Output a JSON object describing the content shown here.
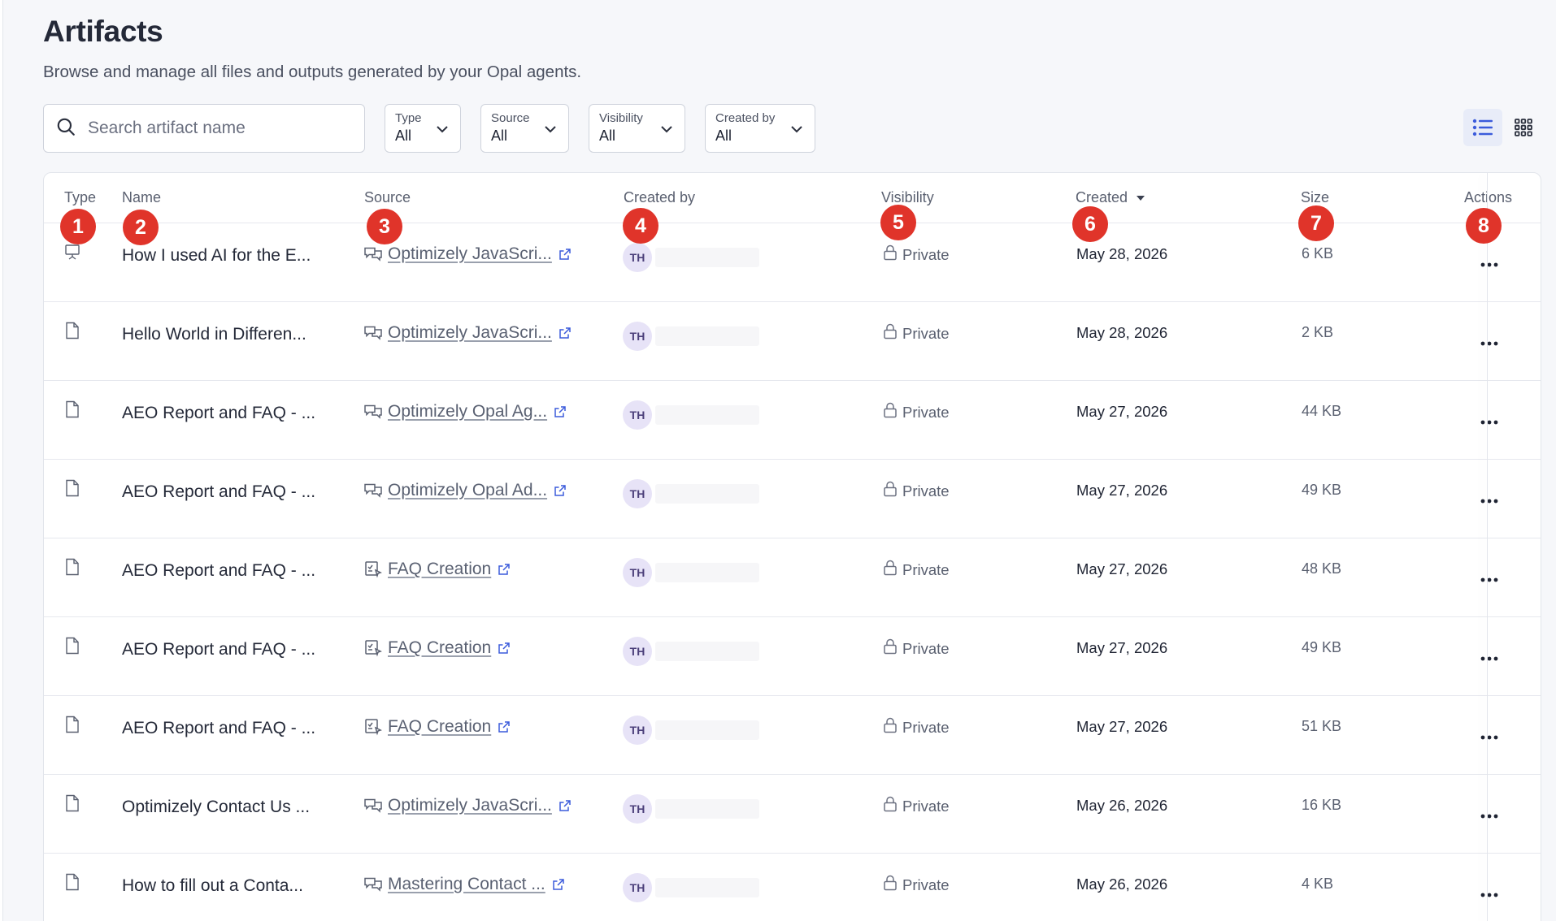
{
  "page": {
    "title": "Artifacts",
    "subtitle": "Browse and manage all files and outputs generated by your Opal agents."
  },
  "search": {
    "placeholder": "Search artifact name",
    "value": ""
  },
  "filters": [
    {
      "label": "Type",
      "value": "All"
    },
    {
      "label": "Source",
      "value": "All"
    },
    {
      "label": "Visibility",
      "value": "All"
    },
    {
      "label": "Created by",
      "value": "All"
    }
  ],
  "view_toggle": {
    "active": "list",
    "list_icon": "list-view-icon",
    "grid_icon": "grid-view-icon"
  },
  "table": {
    "columns": {
      "type": "Type",
      "name": "Name",
      "source": "Source",
      "created_by": "Created by",
      "visibility": "Visibility",
      "created": "Created",
      "size": "Size",
      "actions": "Actions"
    },
    "sort": {
      "column": "Created",
      "direction": "desc"
    },
    "rows": [
      {
        "type_icon": "presentation-icon",
        "name": "How I used AI for the E...",
        "source_icon": "chat-icon",
        "source": "Optimizely JavaScri...",
        "initials": "TH",
        "visibility": "Private",
        "created": "May 28, 2026",
        "size": "6 KB"
      },
      {
        "type_icon": "file-icon",
        "name": "Hello World in Differen...",
        "source_icon": "chat-icon",
        "source": "Optimizely JavaScri...",
        "initials": "TH",
        "visibility": "Private",
        "created": "May 28, 2026",
        "size": "2 KB"
      },
      {
        "type_icon": "file-icon",
        "name": "AEO Report and FAQ - ...",
        "source_icon": "chat-icon",
        "source": "Optimizely Opal Ag...",
        "initials": "TH",
        "visibility": "Private",
        "created": "May 27, 2026",
        "size": "44 KB"
      },
      {
        "type_icon": "file-icon",
        "name": "AEO Report and FAQ - ...",
        "source_icon": "chat-icon",
        "source": "Optimizely Opal Ad...",
        "initials": "TH",
        "visibility": "Private",
        "created": "May 27, 2026",
        "size": "49 KB"
      },
      {
        "type_icon": "file-icon",
        "name": "AEO Report and FAQ - ...",
        "source_icon": "workflow-icon",
        "source": "FAQ Creation",
        "initials": "TH",
        "visibility": "Private",
        "created": "May 27, 2026",
        "size": "48 KB"
      },
      {
        "type_icon": "file-icon",
        "name": "AEO Report and FAQ - ...",
        "source_icon": "workflow-icon",
        "source": "FAQ Creation",
        "initials": "TH",
        "visibility": "Private",
        "created": "May 27, 2026",
        "size": "49 KB"
      },
      {
        "type_icon": "file-icon",
        "name": "AEO Report and FAQ - ...",
        "source_icon": "workflow-icon",
        "source": "FAQ Creation",
        "initials": "TH",
        "visibility": "Private",
        "created": "May 27, 2026",
        "size": "51 KB"
      },
      {
        "type_icon": "file-icon",
        "name": "Optimizely Contact Us ...",
        "source_icon": "chat-icon",
        "source": "Optimizely JavaScri...",
        "initials": "TH",
        "visibility": "Private",
        "created": "May 26, 2026",
        "size": "16 KB"
      },
      {
        "type_icon": "file-icon",
        "name": "How to fill out a Conta...",
        "source_icon": "chat-icon",
        "source": "Mastering Contact ...",
        "initials": "TH",
        "visibility": "Private",
        "created": "May 26, 2026",
        "size": "4 KB"
      }
    ]
  },
  "annotations": [
    "1",
    "2",
    "3",
    "4",
    "5",
    "6",
    "7",
    "8"
  ],
  "colors": {
    "badge": "#e0342a",
    "accent": "#3b5bdb",
    "avatar_bg": "#e7e3f7"
  }
}
